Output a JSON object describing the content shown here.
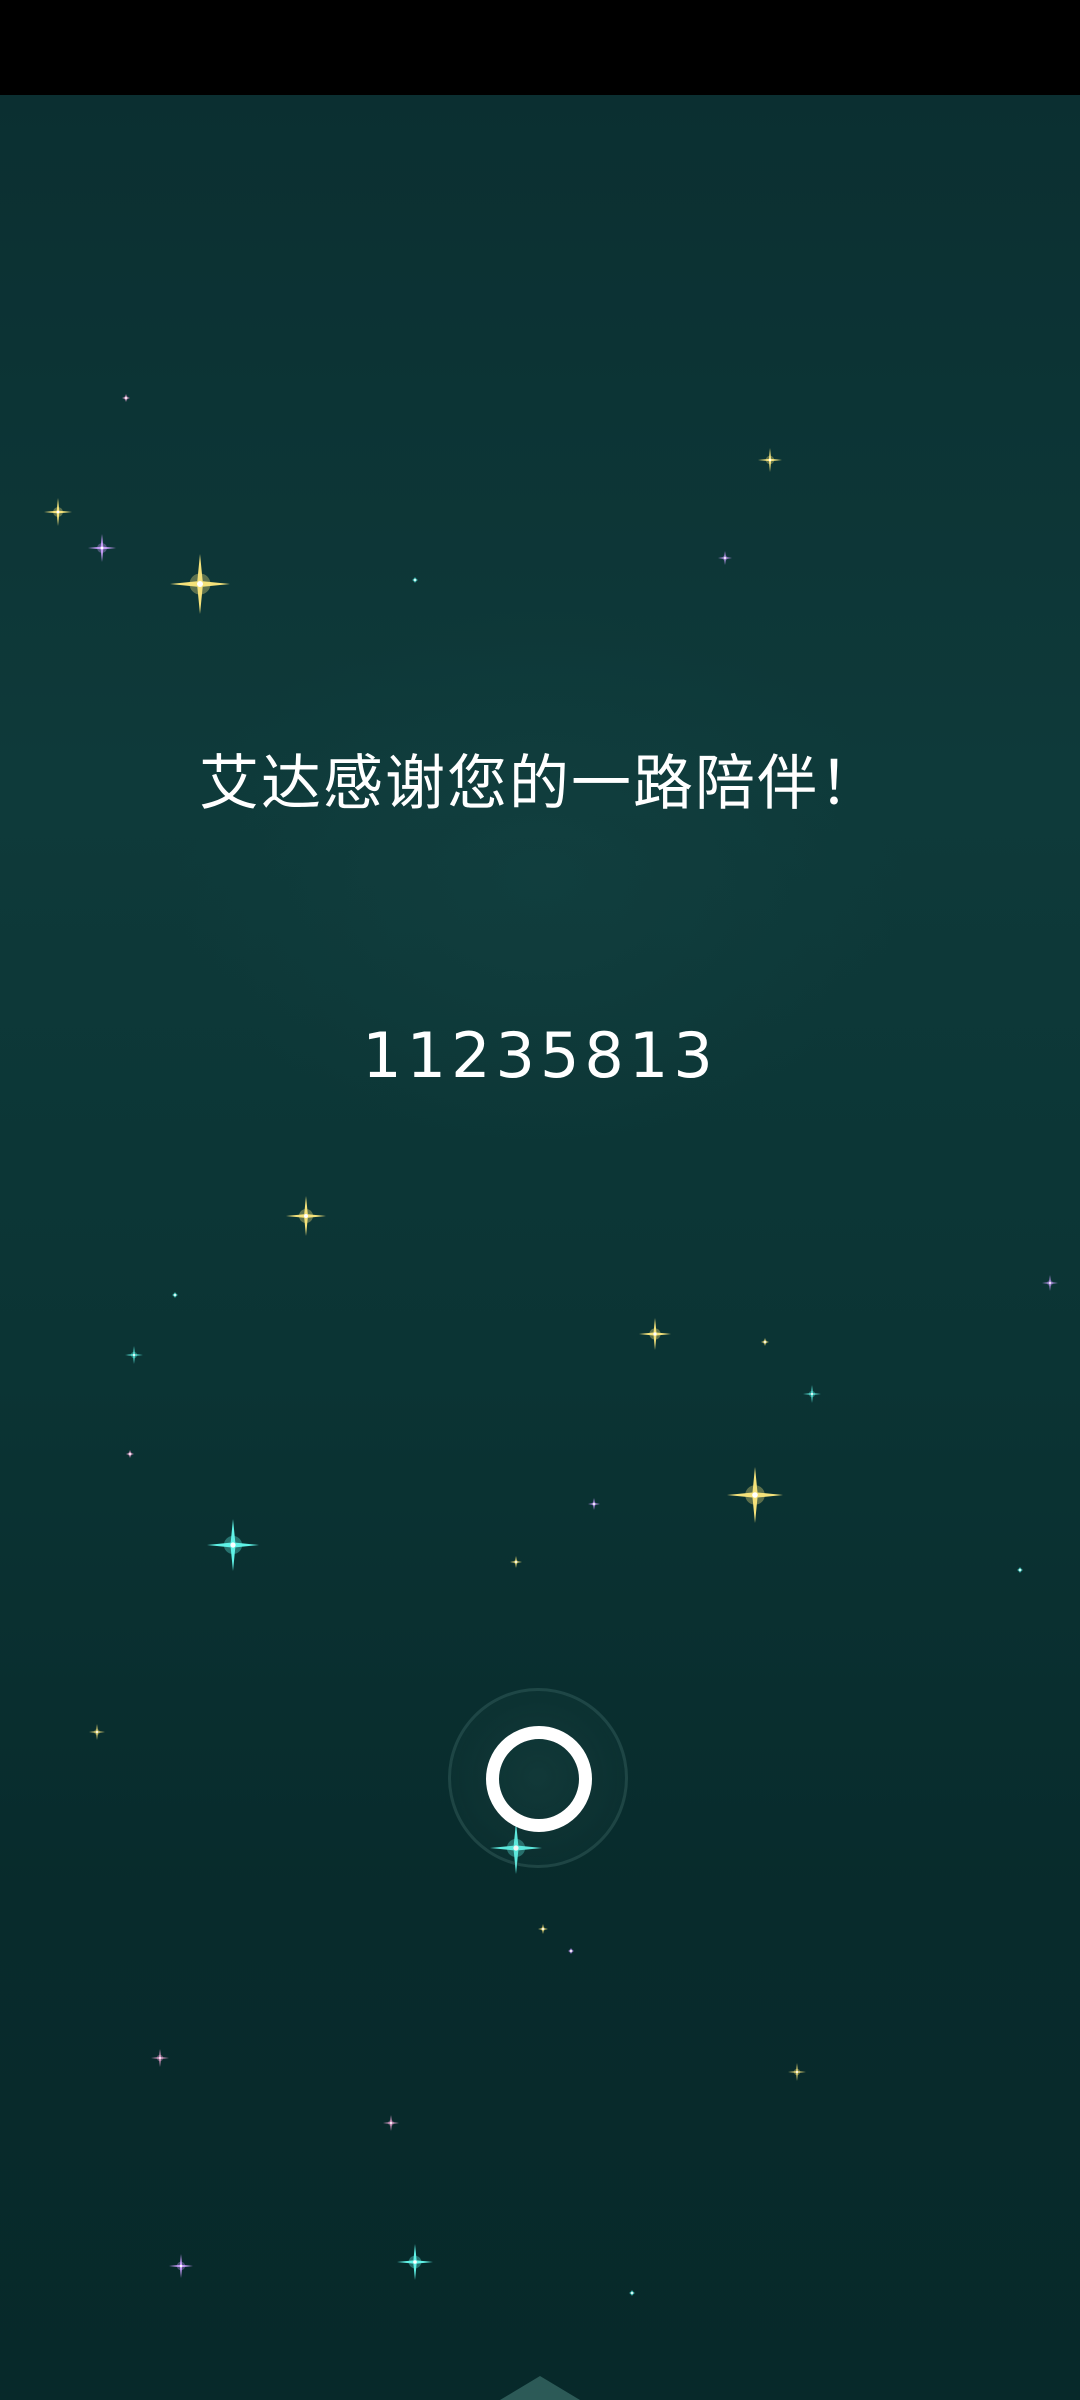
{
  "message": "艾达感谢您的一路陪伴！",
  "user_number": "11235813",
  "colors": {
    "status_bar": "#000000",
    "background_top": "#0b2f31",
    "background_bottom": "#07292a",
    "text": "#ffffff",
    "star_yellow": "#f5e27a",
    "star_cyan": "#5ff2e6",
    "star_violet": "#c49af5",
    "star_pink": "#f0a6d6"
  },
  "icons": {
    "home_button": "ring-icon",
    "bottom_handle": "chevron-up-icon"
  }
}
